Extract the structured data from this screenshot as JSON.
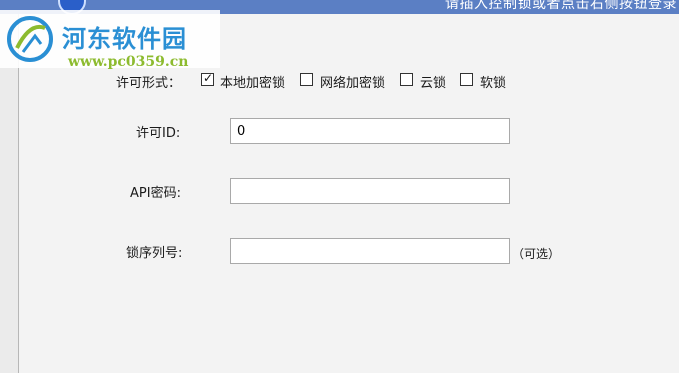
{
  "titlebar": {
    "text": "请插入控制锁或者点击右侧按钮登录"
  },
  "watermark": {
    "title": "河东软件园",
    "url": "www.pc0359.cn"
  },
  "form": {
    "license_type_label": "许可形式：",
    "license_options": [
      {
        "label": "本地加密锁",
        "checked": true
      },
      {
        "label": "网络加密锁",
        "checked": false
      },
      {
        "label": "云锁",
        "checked": false
      },
      {
        "label": "软锁",
        "checked": false
      }
    ],
    "license_id_label": "许可ID:",
    "license_id_value": "0",
    "api_password_label": "API密码:",
    "api_password_value": "",
    "lock_serial_label": "锁序列号:",
    "lock_serial_value": "",
    "optional_note": "（可选）"
  }
}
